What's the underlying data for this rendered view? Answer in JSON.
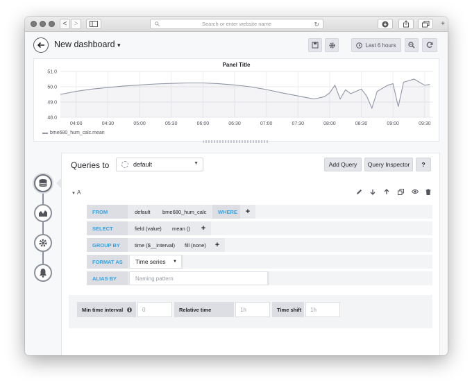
{
  "browser": {
    "url_placeholder": "Search or enter website name",
    "back_label": "<",
    "forward_label": ">"
  },
  "navbar": {
    "title": "New dashboard",
    "title_caret": "▾",
    "time_range": "Last 6 hours"
  },
  "panel": {
    "title": "Panel Title",
    "legend": "bme680_hum_calc.mean"
  },
  "chart_data": {
    "type": "line",
    "title": "Panel Title",
    "y_ticks": [
      "51.0",
      "50.0",
      "49.0",
      "48.0"
    ],
    "x_ticks": [
      "04:00",
      "04:30",
      "05:00",
      "05:30",
      "06:00",
      "06:30",
      "07:00",
      "07:30",
      "08:00",
      "08:30",
      "09:00",
      "09:30"
    ],
    "ylim": [
      48.0,
      51.0
    ],
    "grid": true,
    "legend_position": "bottom-left",
    "series": [
      {
        "name": "bme680_hum_calc.mean",
        "color": "#8f95a3",
        "x": [
          "03:45",
          "04:00",
          "04:15",
          "04:30",
          "04:45",
          "05:00",
          "05:15",
          "05:30",
          "05:45",
          "06:00",
          "06:15",
          "06:30",
          "06:45",
          "07:00",
          "07:15",
          "07:30",
          "07:45",
          "07:55",
          "08:00",
          "08:05",
          "08:10",
          "08:15",
          "08:20",
          "08:25",
          "08:30",
          "08:35",
          "08:40",
          "08:45",
          "08:50",
          "08:55",
          "09:00",
          "09:05",
          "09:10",
          "09:15",
          "09:20",
          "09:25",
          "09:30",
          "09:35"
        ],
        "y": [
          49.5,
          49.7,
          49.85,
          49.95,
          50.05,
          50.12,
          50.18,
          50.22,
          50.25,
          50.25,
          50.2,
          50.12,
          50.0,
          49.82,
          49.6,
          49.4,
          49.2,
          49.35,
          49.6,
          50.1,
          49.2,
          49.8,
          49.55,
          49.7,
          49.85,
          49.4,
          48.6,
          49.7,
          49.9,
          50.1,
          50.2,
          48.7,
          50.3,
          50.4,
          50.5,
          50.3,
          50.1,
          50.15
        ]
      }
    ]
  },
  "editor": {
    "queries_to_label": "Queries to",
    "datasource": "default",
    "add_query": "Add Query",
    "query_inspector": "Query Inspector",
    "help": "?",
    "query": {
      "ref_id": "A",
      "from_label": "FROM",
      "from_policy": "default",
      "from_measurement": "bme680_hum_calc",
      "where_label": "WHERE",
      "select_label": "SELECT",
      "select_field": "field (value)",
      "select_func": "mean ()",
      "group_by_label": "GROUP BY",
      "group_by_time": "time ($__interval)",
      "group_by_fill": "fill (none)",
      "format_as_label": "FORMAT AS",
      "format_as_value": "Time series",
      "alias_by_label": "ALIAS BY",
      "alias_placeholder": "Naming pattern",
      "plus": "+"
    },
    "options": {
      "min_interval_label": "Min time interval",
      "min_interval_placeholder": "0",
      "relative_time_label": "Relative time",
      "relative_time_placeholder": "1h",
      "time_shift_label": "Time shift",
      "time_shift_placeholder": "1h"
    }
  },
  "rail": {
    "items": [
      "queries-icon",
      "visualization-icon",
      "general-icon",
      "alert-icon"
    ]
  }
}
